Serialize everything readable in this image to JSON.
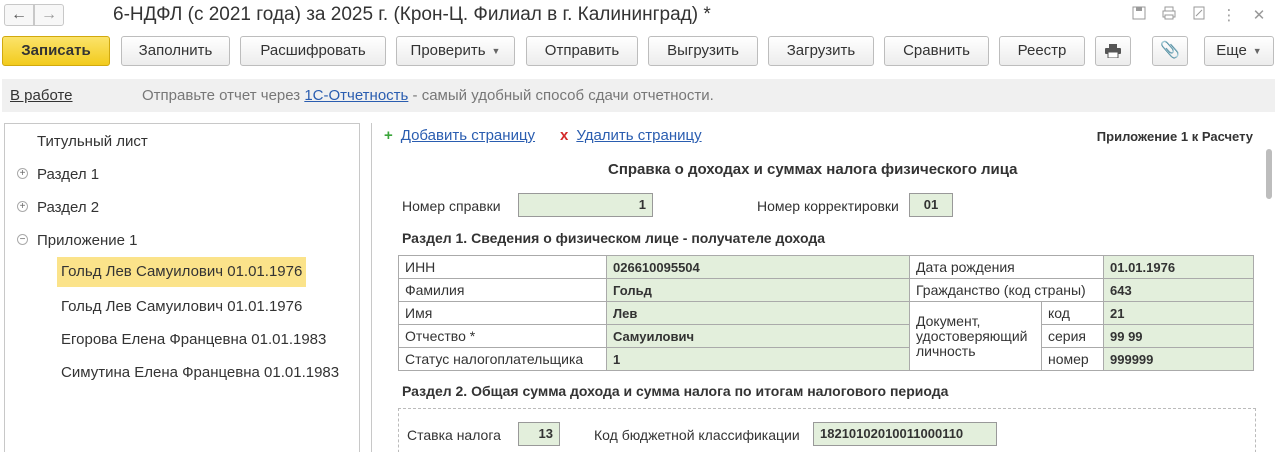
{
  "window": {
    "title": "6-НДФЛ (с 2021 года) за 2025 г. (Крон-Ц. Филиал в г. Калининград) *",
    "back_icon": "←",
    "forward_icon": "→",
    "icons": [
      "save-icon",
      "print-icon",
      "link-icon",
      "more-icon",
      "close-icon"
    ]
  },
  "toolbar": {
    "save": "Записать",
    "fill": "Заполнить",
    "decode": "Расшифровать",
    "check": "Проверить",
    "send": "Отправить",
    "export": "Выгрузить",
    "import": "Загрузить",
    "compare": "Сравнить",
    "registry": "Реестр",
    "more": "Еще"
  },
  "infobar": {
    "status": "В работе",
    "text_before": "Отправьте отчет через ",
    "link": "1С-Отчетность",
    "text_after": " - самый удобный способ сдачи отчетности."
  },
  "tree": {
    "title_page": "Титульный лист",
    "section1": "Раздел 1",
    "section2": "Раздел 2",
    "appendix1": "Приложение 1",
    "persons": [
      "Гольд Лев Самуилович 01.01.1976",
      "Гольд Лев Самуилович 01.01.1976",
      "Егорова Елена Францевна 01.01.1983",
      "Симутина Елена Францевна 01.01.1983"
    ]
  },
  "form": {
    "add_page": "Добавить страницу",
    "delete_page": "Удалить страницу",
    "appendix_label": "Приложение 1 к Расчету",
    "title": "Справка о доходах и суммах налога физического лица",
    "cert_number_label": "Номер справки",
    "cert_number": "1",
    "correction_label": "Номер корректировки",
    "correction": "01",
    "section1_title": "Раздел 1. Сведения о физическом лице - получателе дохода",
    "inn_label": "ИНН",
    "inn": "026610095504",
    "surname_label": "Фамилия",
    "surname": "Гольд",
    "name_label": "Имя",
    "name": "Лев",
    "patronymic_label": "Отчество *",
    "patronymic": "Самуилович",
    "taxpayer_status_label": "Статус налогоплательщика",
    "taxpayer_status": "1",
    "birth_label": "Дата рождения",
    "birth": "01.01.1976",
    "citizenship_label": "Гражданство (код страны)",
    "citizenship": "643",
    "doc_label": "Документ, удостоверяющий личность",
    "code_label": "код",
    "code": "21",
    "series_label": "серия",
    "series": "99 99",
    "number_label": "номер",
    "number": "999999",
    "section2_title": "Раздел 2. Общая сумма дохода и сумма налога по итогам налогового периода",
    "tax_rate_label": "Ставка налога",
    "tax_rate": "13",
    "kbk_label": "Код бюджетной классификации",
    "kbk": "18210102010011000110"
  },
  "colors": {
    "primary_button": "#f2cb1d",
    "field_bg": "#e3efdc",
    "selected_row": "#fbe38a",
    "link": "#2a5db0"
  }
}
